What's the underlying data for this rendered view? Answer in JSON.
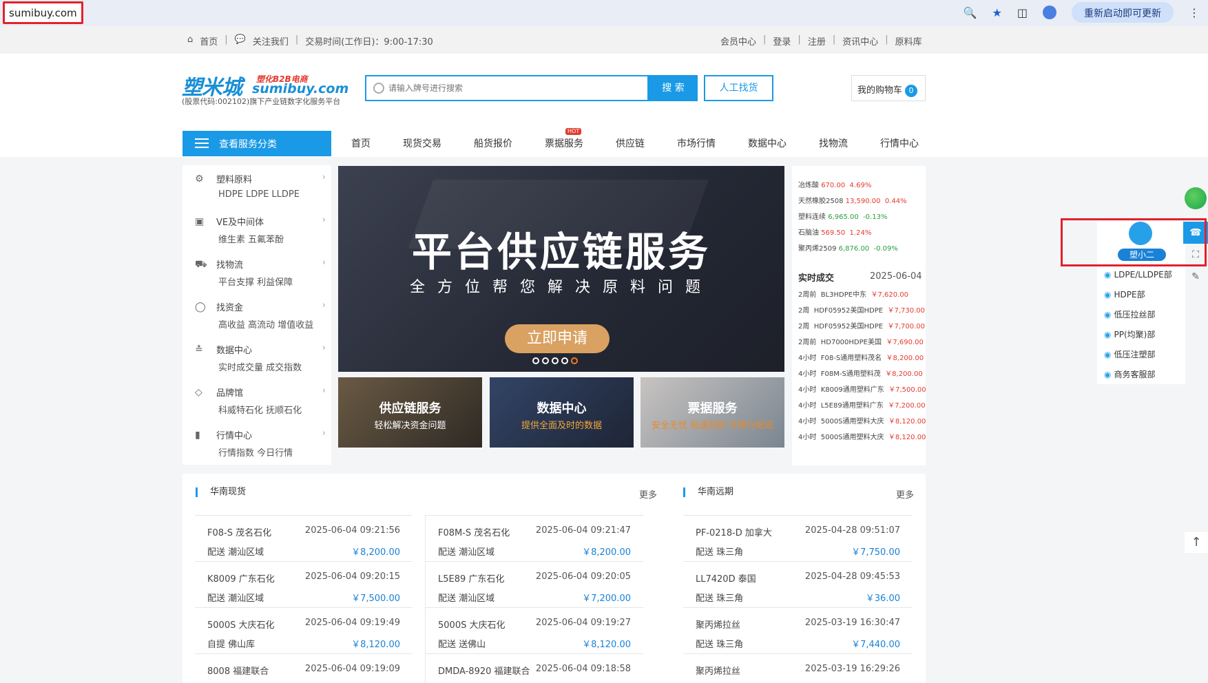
{
  "browser": {
    "url": "sumibuy.com",
    "update_label": "重新启动即可更新"
  },
  "topbar": {
    "home": "首页",
    "follow": "关注我们",
    "hours": "交易时间(工作日)：9:00-17:30",
    "links": [
      "会员中心",
      "登录",
      "注册",
      "资讯中心",
      "原料库"
    ]
  },
  "header": {
    "logo_main": "塑米城",
    "logo_sub1": "塑化B2B电商",
    "logo_sub2": "sumibuy.com",
    "logo_tagline": "(股票代码:002102)旗下产业链数字化服务平台",
    "search_placeholder": "请输入牌号进行搜索",
    "search_button": "搜 索",
    "find_button": "人工找货",
    "cart_label": "我的购物车",
    "cart_count": "0"
  },
  "nav": {
    "category_button": "查看服务分类",
    "items": [
      "首页",
      "现货交易",
      "船货报价",
      "票据服务",
      "供应链",
      "市场行情",
      "数据中心",
      "找物流",
      "行情中心"
    ],
    "hot_badge": "HOT"
  },
  "categories": [
    {
      "title": "塑料原料",
      "sub": "HDPE LDPE LLDPE",
      "icon": "resin-icon"
    },
    {
      "title": "VE及中间体",
      "sub": "维生素 五氟苯酚",
      "icon": "chemical-icon"
    },
    {
      "title": "找物流",
      "sub": "平台支撑 利益保障",
      "icon": "truck-icon"
    },
    {
      "title": "找资金",
      "sub": "高收益 高流动 增值收益",
      "icon": "money-bag-icon"
    },
    {
      "title": "数据中心",
      "sub": "实时成交量 成交指数",
      "icon": "chart-icon"
    },
    {
      "title": "品牌馆",
      "sub": "科威特石化 抚顺石化",
      "icon": "diamond-icon"
    },
    {
      "title": "行情中心",
      "sub": "行情指数 今日行情",
      "icon": "bar-chart-icon"
    }
  ],
  "banner": {
    "title": "平台供应链服务",
    "subtitle": "全方位帮您解决原料问题",
    "cta": "立即申请"
  },
  "promos": [
    {
      "title": "供应链服务",
      "sub": "轻松解决资金问题"
    },
    {
      "title": "数据中心",
      "sub": "提供全面及时的数据"
    },
    {
      "title": "票据服务",
      "sub": "安全无忧 极速回款 可跨行贴现"
    }
  ],
  "market": {
    "quotes": [
      {
        "name": "冶炼酸",
        "price": "670.00",
        "change": "4.69%",
        "dir": "up"
      },
      {
        "name": "天然橡胶2508",
        "price": "13,590.00",
        "change": "0.44%",
        "dir": "up"
      },
      {
        "name": "塑料连续",
        "price": "6,965.00",
        "change": "-0.13%",
        "dir": "down"
      },
      {
        "name": "石脑油",
        "price": "569.50",
        "change": "1.24%",
        "dir": "up"
      },
      {
        "name": "聚丙烯2509",
        "price": "6,876.00",
        "change": "-0.09%",
        "dir": "down"
      }
    ],
    "realtime_title": "实时成交",
    "realtime_date": "2025-06-04",
    "deals": [
      {
        "time": "2周前",
        "product": "BL3HDPE中东",
        "price": "￥7,620.00"
      },
      {
        "time": "2周",
        "product": "HDF05952美国HDPE",
        "price": "￥7,730.00"
      },
      {
        "time": "2周",
        "product": "HDF05952美国HDPE",
        "price": "￥7,700.00"
      },
      {
        "time": "2周前",
        "product": "HD7000HDPE美国",
        "price": "￥7,690.00"
      },
      {
        "time": "4小时",
        "product": "F08-S通用塑料茂名",
        "price": "￥8,200.00"
      },
      {
        "time": "4小时",
        "product": "F08M-S通用塑料茂",
        "price": "￥8,200.00"
      },
      {
        "time": "4小时",
        "product": "K8009通用塑料广东",
        "price": "￥7,500.00"
      },
      {
        "time": "4小时",
        "product": "L5E89通用塑料广东",
        "price": "￥7,200.00"
      },
      {
        "time": "4小时",
        "product": "5000S通用塑料大庆",
        "price": "￥8,120.00"
      },
      {
        "time": "4小时",
        "product": "5000S通用塑料大庆",
        "price": "￥8,120.00"
      }
    ]
  },
  "south_spot": {
    "title": "华南现货",
    "more": "更多",
    "col1": [
      {
        "name": "F08-S  茂名石化",
        "time": "2025-06-04 09:21:56",
        "loc": "配送   潮汕区域",
        "price": "￥8,200.00"
      },
      {
        "name": "K8009  广东石化",
        "time": "2025-06-04 09:20:15",
        "loc": "配送   潮汕区域",
        "price": "￥7,500.00"
      },
      {
        "name": "5000S  大庆石化",
        "time": "2025-06-04 09:19:49",
        "loc": "自提   佛山库",
        "price": "￥8,120.00"
      },
      {
        "name": "8008  福建联合",
        "time": "2025-06-04 09:19:09",
        "loc": "",
        "price": ""
      }
    ],
    "col2": [
      {
        "name": "F08M-S  茂名石化",
        "time": "2025-06-04 09:21:47",
        "loc": "配送   潮汕区域",
        "price": "￥8,200.00"
      },
      {
        "name": "L5E89  广东石化",
        "time": "2025-06-04 09:20:05",
        "loc": "配送   潮汕区域",
        "price": "￥7,200.00"
      },
      {
        "name": "5000S  大庆石化",
        "time": "2025-06-04 09:19:27",
        "loc": "配送   送佛山",
        "price": "￥8,120.00"
      },
      {
        "name": "DMDA-8920  福建联合",
        "time": "2025-06-04 09:18:58",
        "loc": "",
        "price": ""
      }
    ]
  },
  "south_futures": {
    "title": "华南远期",
    "more": "更多",
    "rows": [
      {
        "name": "PF-0218-D  加拿大",
        "time": "2025-04-28 09:51:07",
        "loc": "配送   珠三角",
        "price": "￥7,750.00"
      },
      {
        "name": "LL7420D  泰国",
        "time": "2025-04-28 09:45:53",
        "loc": "配送   珠三角",
        "price": "￥36.00"
      },
      {
        "name": "聚丙烯拉丝",
        "time": "2025-03-19 16:30:47",
        "loc": "配送   珠三角",
        "price": "￥7,440.00"
      },
      {
        "name": "聚丙烯拉丝",
        "time": "2025-03-19 16:29:26",
        "loc": "",
        "price": ""
      }
    ]
  },
  "service": {
    "agent_name": "塑小二",
    "departments": [
      "LDPE/LLDPE部",
      "HDPE部",
      "低压拉丝部",
      "PP(均聚)部",
      "低压注塑部",
      "商务客服部"
    ]
  },
  "colors": {
    "accent": "#1a9ae6",
    "price_red": "#e33a2f",
    "price_green": "#2a9e3a",
    "highlight_box": "#e3202a"
  }
}
